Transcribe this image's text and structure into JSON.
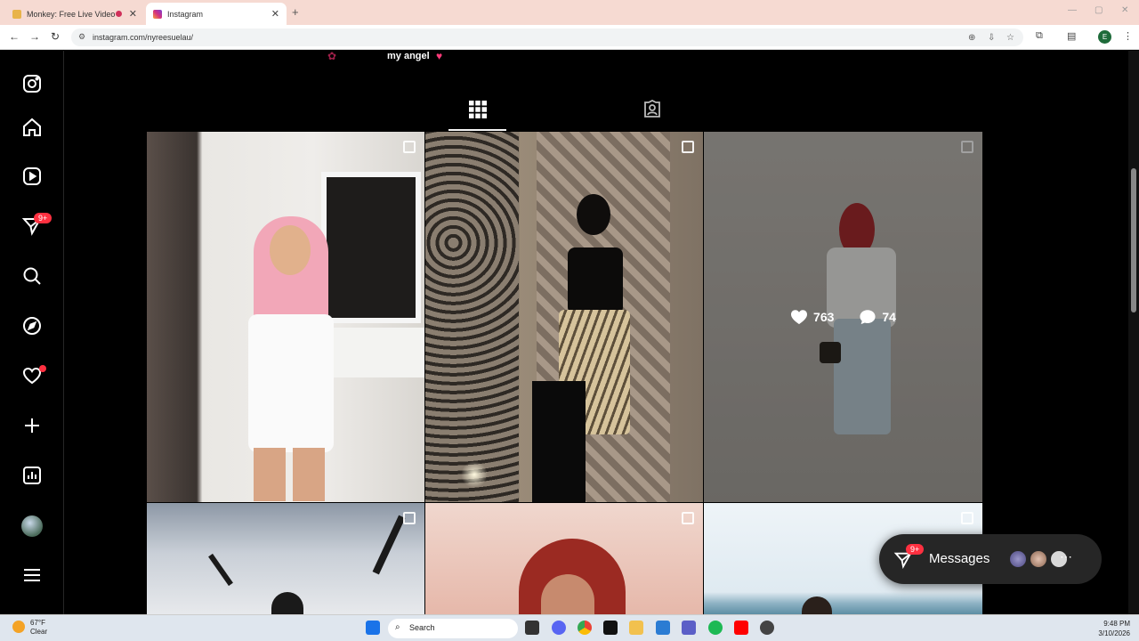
{
  "browser": {
    "tabs": [
      {
        "title": "Monkey: Free Live Video Ch",
        "active": false
      },
      {
        "title": "Instagram",
        "active": true
      }
    ],
    "url": "instagram.com/nyreesuelau/",
    "profile_initial": "E"
  },
  "sidebar": {
    "items": [
      {
        "name": "instagram-logo-icon"
      },
      {
        "name": "home-icon"
      },
      {
        "name": "reels-icon"
      },
      {
        "name": "messages-icon",
        "badge": "9+"
      },
      {
        "name": "search-icon"
      },
      {
        "name": "explore-icon"
      },
      {
        "name": "notifications-icon"
      },
      {
        "name": "create-icon"
      },
      {
        "name": "dashboard-icon"
      },
      {
        "name": "profile-avatar"
      },
      {
        "name": "more-menu-icon"
      }
    ]
  },
  "profile": {
    "bio_line": "my angel"
  },
  "profile_tabs": [
    {
      "name": "posts-grid-tab",
      "active": true
    },
    {
      "name": "tagged-tab",
      "active": false
    }
  ],
  "posts": [
    {
      "multi": true
    },
    {
      "multi": true
    },
    {
      "multi": true,
      "hovered": true,
      "likes": "763",
      "comments": "74"
    },
    {
      "multi": true
    },
    {
      "multi": true
    },
    {
      "multi": true
    }
  ],
  "messages": {
    "label": "Messages",
    "badge": "9+"
  },
  "taskbar": {
    "weather_temp": "67°F",
    "weather_cond": "Clear",
    "search_label": "Search",
    "time": "9:48 PM",
    "date": "3/10/2026"
  },
  "colors": {
    "accent_red": "#ff3040",
    "chrome_tabbar": "#f6dad2"
  }
}
